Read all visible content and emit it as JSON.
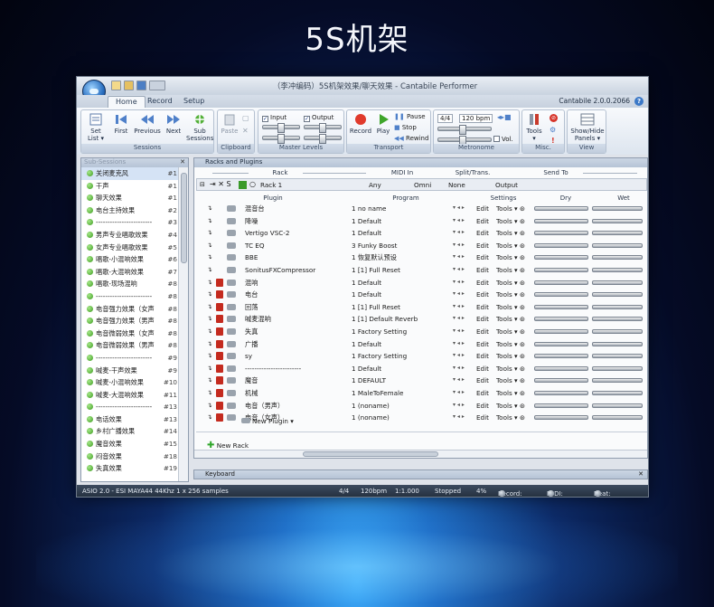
{
  "headline": "5S机架",
  "app": {
    "title": "（李冲编码）5S机架效果/聊天效果 - Cantabile Performer",
    "version": "Cantabile 2.0.0.2066"
  },
  "tabs": [
    "Home",
    "Record",
    "Setup"
  ],
  "ribbon": {
    "sessions": {
      "label": "Sessions",
      "buttons": [
        "Set List",
        "First",
        "Previous",
        "Next",
        "Sub Sessions"
      ]
    },
    "clipboard": {
      "label": "Clipboard",
      "buttons": [
        "Paste"
      ]
    },
    "master": {
      "label": "Master Levels",
      "input": "Input",
      "output": "Output"
    },
    "transport": {
      "label": "Transport",
      "record": "Record",
      "play": "Play",
      "pause": "Pause",
      "stop": "Stop",
      "rewind": "Rewind"
    },
    "metronome": {
      "label": "Metronome",
      "timesig": "4/4",
      "tempo": "120 bpm",
      "vol": "Vol."
    },
    "misc": {
      "label": "Misc.",
      "tools": "Tools"
    },
    "view": {
      "label": "View",
      "showhide": "Show/Hide Panels"
    }
  },
  "sidebar": {
    "title": "Sub-Sessions",
    "items": [
      {
        "label": "关闭麦克风",
        "num": "#1",
        "sel": true
      },
      {
        "label": "干声",
        "num": "#1"
      },
      {
        "label": "聊天效果",
        "num": "#1"
      },
      {
        "label": "电台主持效果",
        "num": "#2"
      },
      {
        "label": "------------------------",
        "num": "#3"
      },
      {
        "label": "男声专业唱歌效果",
        "num": "#4"
      },
      {
        "label": "女声专业唱歌效果",
        "num": "#5"
      },
      {
        "label": "唱歌-小混响效果",
        "num": "#6"
      },
      {
        "label": "唱歌-大混响效果",
        "num": "#7"
      },
      {
        "label": "唱歌-现场混响",
        "num": "#8"
      },
      {
        "label": "------------------------",
        "num": "#8"
      },
      {
        "label": "电音强力效果（女声",
        "num": "#8"
      },
      {
        "label": "电音强力效果（男声",
        "num": "#8"
      },
      {
        "label": "电音微弱效果（女声",
        "num": "#8"
      },
      {
        "label": "电音微弱效果（男声",
        "num": "#8"
      },
      {
        "label": "------------------------",
        "num": "#9"
      },
      {
        "label": "喊麦-干声效果",
        "num": "#9"
      },
      {
        "label": "喊麦-小混响效果",
        "num": "#10"
      },
      {
        "label": "喊麦-大混响效果",
        "num": "#11"
      },
      {
        "label": "------------------------",
        "num": "#13"
      },
      {
        "label": "电话效果",
        "num": "#13"
      },
      {
        "label": "乡村广播效果",
        "num": "#14"
      },
      {
        "label": "魔音效果",
        "num": "#15"
      },
      {
        "label": "闷音效果",
        "num": "#18"
      },
      {
        "label": "失真效果",
        "num": "#19"
      }
    ]
  },
  "racks": {
    "title": "Racks and Plugins",
    "headers": {
      "rack": "Rack",
      "midi": "MIDI In",
      "split": "Split/Trans.",
      "send": "Send To",
      "plugin": "Plugin",
      "program": "Program",
      "settings": "Settings",
      "dry": "Dry",
      "wet": "Wet"
    },
    "rack": {
      "name": "Rack 1",
      "midi1": "Any",
      "midi2": "Omni",
      "split": "None",
      "send": "Output"
    },
    "plugins": [
      {
        "name": "混音台",
        "program": "1 no name",
        "red": false
      },
      {
        "name": "降噪",
        "program": "1 Default",
        "red": false
      },
      {
        "name": "Vertigo VSC-2",
        "program": "1 Default",
        "red": false
      },
      {
        "name": "TC EQ",
        "program": "3 Funky Boost",
        "red": false
      },
      {
        "name": "BBE",
        "program": "1 恢复默认预设",
        "red": false
      },
      {
        "name": "SonitusFXCompressor",
        "program": "1 [1] Full Reset",
        "red": false
      },
      {
        "name": "混响",
        "program": "1 Default",
        "red": true
      },
      {
        "name": "电台",
        "program": "1 Default",
        "red": true
      },
      {
        "name": "回荡",
        "program": "1 [1] Full Reset",
        "red": true
      },
      {
        "name": "喊麦混响",
        "program": "1 [1] Default Reverb",
        "red": true
      },
      {
        "name": "失真",
        "program": "1 Factory Setting",
        "red": true
      },
      {
        "name": "广播",
        "program": "1 Default",
        "red": true
      },
      {
        "name": "sy",
        "program": "1 Factory Setting",
        "red": true
      },
      {
        "name": "------------------------",
        "program": "1 Default",
        "red": true
      },
      {
        "name": "魔音",
        "program": "1 DEFAULT",
        "red": true
      },
      {
        "name": "机械",
        "program": "1 MaleToFemale",
        "red": true
      },
      {
        "name": "电音（男声）",
        "program": "1 (noname)",
        "red": true
      },
      {
        "name": "电音（女声）",
        "program": "1 (noname)",
        "red": true
      }
    ],
    "edit": "Edit",
    "tools": "Tools",
    "new_plugin": "New Plugin",
    "new_rack": "New Rack"
  },
  "keyboard": {
    "title": "Keyboard"
  },
  "status": {
    "driver": "ASIO 2.0 - ESI MAYA44 44Khz 1 x 256 samples",
    "timesig": "4/4",
    "tempo": "120bpm",
    "position": "1:1.000",
    "state": "Stopped",
    "cpu": "4%",
    "record": "Record:",
    "midi": "MIDI:",
    "beat": "Beat:"
  }
}
